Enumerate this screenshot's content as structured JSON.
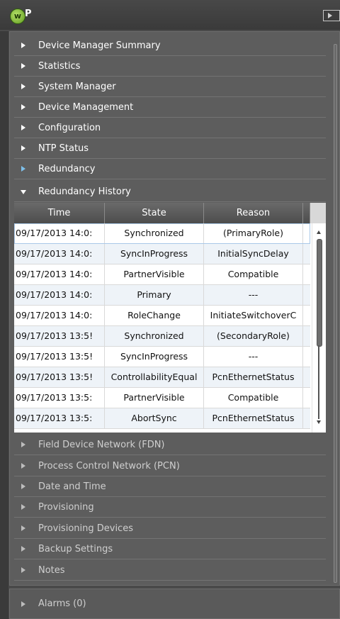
{
  "app": {
    "title": "P",
    "logo_letter": "w"
  },
  "sections_top": [
    {
      "label": "Device Manager Summary",
      "state": "collapsed"
    },
    {
      "label": "Statistics",
      "state": "collapsed"
    },
    {
      "label": "System Manager",
      "state": "collapsed"
    },
    {
      "label": "Device Management",
      "state": "collapsed"
    },
    {
      "label": "Configuration",
      "state": "collapsed"
    },
    {
      "label": "NTP Status",
      "state": "collapsed"
    },
    {
      "label": "Redundancy",
      "state": "collapsed",
      "arrow_color": "#7ec0ea"
    },
    {
      "label": "Redundancy History",
      "state": "expanded"
    }
  ],
  "history_table": {
    "columns": [
      "Time",
      "State",
      "Reason"
    ],
    "rows": [
      {
        "time": "09/17/2013 14:0:",
        "state": "Synchronized",
        "reason": "(PrimaryRole)"
      },
      {
        "time": "09/17/2013 14:0:",
        "state": "SyncInProgress",
        "reason": "InitialSyncDelay"
      },
      {
        "time": "09/17/2013 14:0:",
        "state": "PartnerVisible",
        "reason": "Compatible"
      },
      {
        "time": "09/17/2013 14:0:",
        "state": "Primary",
        "reason": "---"
      },
      {
        "time": "09/17/2013 14:0:",
        "state": "RoleChange",
        "reason": "InitiateSwitchoverC"
      },
      {
        "time": "09/17/2013 13:5!",
        "state": "Synchronized",
        "reason": "(SecondaryRole)"
      },
      {
        "time": "09/17/2013 13:5!",
        "state": "SyncInProgress",
        "reason": "---"
      },
      {
        "time": "09/17/2013 13:5!",
        "state": "ControllabilityEqual",
        "reason": "PcnEthernetStatus"
      },
      {
        "time": "09/17/2013 13:5:",
        "state": "PartnerVisible",
        "reason": "Compatible"
      },
      {
        "time": "09/17/2013 13:5:",
        "state": "AbortSync",
        "reason": "PcnEthernetStatus"
      }
    ]
  },
  "sections_bottom": [
    {
      "label": "Field Device Network (FDN)",
      "state": "collapsed"
    },
    {
      "label": "Process Control Network (PCN)",
      "state": "collapsed"
    },
    {
      "label": "Date and Time",
      "state": "collapsed"
    },
    {
      "label": "Provisioning",
      "state": "collapsed"
    },
    {
      "label": "Provisioning Devices",
      "state": "collapsed"
    },
    {
      "label": "Backup Settings",
      "state": "collapsed"
    },
    {
      "label": "Notes",
      "state": "collapsed"
    }
  ],
  "alarms": {
    "label": "Alarms (0)"
  },
  "colors": {
    "background": "#4a4a4a",
    "panel": "#5d5d5d",
    "accent_arrow": "#7ec0ea",
    "logo_green": "#7cc23a"
  }
}
